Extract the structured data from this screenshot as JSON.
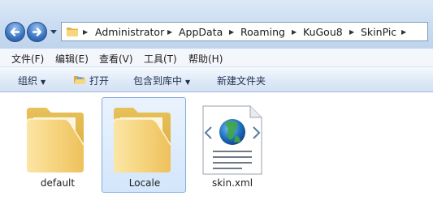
{
  "navigation": {
    "back_icon": "back-arrow-icon",
    "forward_icon": "forward-arrow-icon",
    "recent_icon": "chevron-down-icon"
  },
  "address_bar": {
    "folder_icon": "folder-icon",
    "separator": "▶",
    "breadcrumbs": [
      "Administrator",
      "AppData",
      "Roaming",
      "KuGou8",
      "SkinPic"
    ]
  },
  "menu": {
    "items": [
      "文件(F)",
      "编辑(E)",
      "查看(V)",
      "工具(T)",
      "帮助(H)"
    ]
  },
  "toolbar": {
    "organize_label": "组织",
    "open_label": "打开",
    "include_label": "包含到库中",
    "new_folder_label": "新建文件夹",
    "dropdown_arrow": "▼"
  },
  "files": [
    {
      "name": "default",
      "type": "folder",
      "selected": false
    },
    {
      "name": "Locale",
      "type": "folder",
      "selected": true
    },
    {
      "name": "skin.xml",
      "type": "xml-file",
      "selected": false
    }
  ],
  "colors": {
    "selection_bg": "#d3e6fb",
    "selection_border": "#84acdd",
    "folder_yellow": "#f3cf6a"
  }
}
